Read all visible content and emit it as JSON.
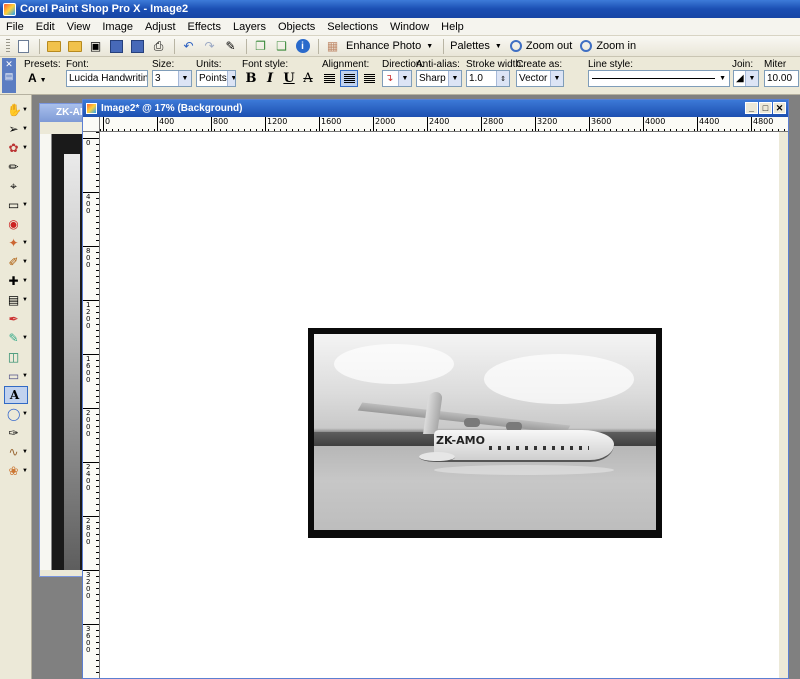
{
  "app": {
    "title": "Corel Paint Shop Pro X - Image2"
  },
  "menu": [
    "File",
    "Edit",
    "View",
    "Image",
    "Adjust",
    "Effects",
    "Layers",
    "Objects",
    "Selections",
    "Window",
    "Help"
  ],
  "toolbar": {
    "enhance_label": "Enhance Photo",
    "palettes_label": "Palettes",
    "zoom_out_label": "Zoom out",
    "zoom_in_label": "Zoom in"
  },
  "options": {
    "presets_label": "Presets:",
    "font_label": "Font:",
    "font_value": "Lucida Handwriting",
    "size_label": "Size:",
    "size_value": "3",
    "units_label": "Units:",
    "units_value": "Points",
    "font_style_label": "Font style:",
    "bold_glyph": "B",
    "italic_glyph": "I",
    "underline_glyph": "U",
    "strike_glyph": "A",
    "alignment_label": "Alignment:",
    "direction_label": "Direction:",
    "antialias_label": "Anti-alias:",
    "antialias_value": "Sharp",
    "stroke_label": "Stroke width:",
    "stroke_value": "1.0",
    "create_label": "Create as:",
    "create_value": "Vector",
    "line_style_label": "Line style:",
    "join_label": "Join:",
    "miter_label": "Miter limit:",
    "miter_value": "10.00"
  },
  "back_window": {
    "title": "ZK-AM"
  },
  "main_window": {
    "title": "Image2* @ 17% (Background)"
  },
  "ruler": {
    "h_labels": [
      "0",
      "400",
      "800",
      "1200",
      "1600",
      "2000",
      "2400",
      "2800",
      "3200",
      "3600",
      "4000",
      "4400",
      "4800"
    ],
    "v_labels": [
      "0",
      "400",
      "800",
      "1200",
      "1600",
      "2000",
      "2400",
      "2800",
      "3200",
      "3600"
    ]
  },
  "photo": {
    "registration": "ZK-AMO"
  },
  "colors": {
    "title_blue": "#1b4fb3",
    "chrome": "#ece9d8",
    "workspace": "#808080"
  }
}
